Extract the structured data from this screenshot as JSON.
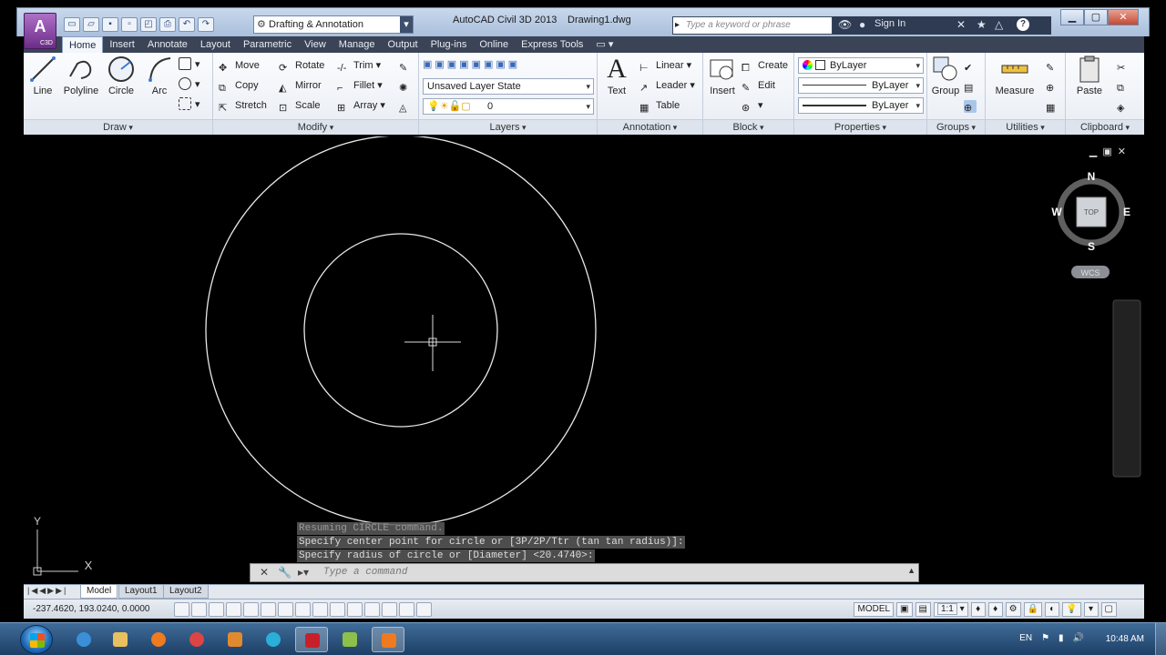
{
  "titlebar": {
    "app_letter": "A",
    "app_badge": "C3D",
    "workspace": "Drafting & Annotation",
    "app_title": "AutoCAD Civil 3D 2013",
    "file_name": "Drawing1.dwg",
    "search_placeholder": "Type a keyword or phrase",
    "sign_in": "Sign In",
    "help": "?"
  },
  "ribbon_tabs": [
    "Home",
    "Insert",
    "Annotate",
    "Layout",
    "Parametric",
    "View",
    "Manage",
    "Output",
    "Plug-ins",
    "Online",
    "Express Tools"
  ],
  "panels": {
    "draw": {
      "title": "Draw",
      "tools": [
        "Line",
        "Polyline",
        "Circle",
        "Arc"
      ]
    },
    "modify": {
      "title": "Modify",
      "tools": [
        "Move",
        "Rotate",
        "Trim",
        "Copy",
        "Mirror",
        "Fillet",
        "Stretch",
        "Scale",
        "Array"
      ]
    },
    "layers": {
      "title": "Layers",
      "layer_state": "Unsaved Layer State",
      "current_layer": "0"
    },
    "annotation": {
      "title": "Annotation",
      "text": "Text",
      "linear": "Linear",
      "leader": "Leader",
      "table": "Table"
    },
    "block": {
      "title": "Block",
      "insert": "Insert",
      "create": "Create",
      "edit": "Edit"
    },
    "properties": {
      "title": "Properties",
      "color": "ByLayer",
      "linetype": "ByLayer",
      "lineweight": "ByLayer"
    },
    "groups": {
      "title": "Groups",
      "group": "Group"
    },
    "utilities": {
      "title": "Utilities",
      "measure": "Measure"
    },
    "clipboard": {
      "title": "Clipboard",
      "paste": "Paste"
    }
  },
  "viewcube": {
    "north": "N",
    "south": "S",
    "east": "E",
    "west": "W",
    "face": "TOP",
    "ucs": "WCS"
  },
  "ucs_icon": {
    "y": "Y",
    "x": "X"
  },
  "command_history": [
    "Resuming CIRCLE command.",
    "Specify center point for circle or [3P/2P/Ttr (tan tan radius)]:",
    "Specify radius of circle or [Diameter] <20.4740>:"
  ],
  "command_line": {
    "placeholder": "Type a command"
  },
  "layout_tabs": [
    "Model",
    "Layout1",
    "Layout2"
  ],
  "statusbar": {
    "coords": "-237.4620, 193.0240, 0.0000",
    "model": "MODEL",
    "scale": "1:1"
  },
  "taskbar": {
    "language": "EN",
    "clock": "10:48 AM"
  }
}
